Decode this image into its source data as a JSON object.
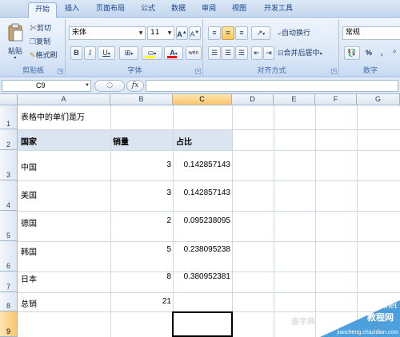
{
  "ribbon": {
    "tabs": [
      "开始",
      "插入",
      "页面布局",
      "公式",
      "数据",
      "审阅",
      "视图",
      "开发工具"
    ],
    "clipboard": {
      "paste": "粘贴",
      "cut": "剪切",
      "copy": "复制",
      "format_painter": "格式刷",
      "label": "剪贴板"
    },
    "font": {
      "name": "宋体",
      "size": "11",
      "grow": "A",
      "shrink": "A",
      "bold": "B",
      "italic": "I",
      "underline": "U",
      "label": "字体",
      "color_swatch": "#ff0000",
      "fill_swatch": "#ffff00",
      "wen": "wén"
    },
    "alignment": {
      "wrap_text": "自动换行",
      "merge_center": "合并后居中",
      "label": "对齐方式"
    },
    "number": {
      "format": "常规",
      "percent": "%",
      "comma": ",",
      "label": "数字"
    }
  },
  "formula_bar": {
    "cell_ref": "C9",
    "fx": "fx",
    "formula": ""
  },
  "grid": {
    "columns": [
      "A",
      "B",
      "C",
      "D",
      "E",
      "F",
      "G"
    ],
    "rows": [
      "1",
      "2",
      "3",
      "4",
      "5",
      "6",
      "7",
      "8",
      "9"
    ],
    "selected_cell": "C9",
    "title": "表格中的单们是万",
    "headers": {
      "country": "国家",
      "sales": "销量",
      "ratio": "占比"
    },
    "records": [
      {
        "country": "中国",
        "sales": "3",
        "ratio": "0.142857143"
      },
      {
        "country": "美国",
        "sales": "3",
        "ratio": "0.142857143"
      },
      {
        "country": "德国",
        "sales": "2",
        "ratio": "0.095238095"
      },
      {
        "country": "韩国",
        "sales": "5",
        "ratio": "0.238095238"
      },
      {
        "country": "日本",
        "sales": "8",
        "ratio": "0.380952381"
      }
    ],
    "total": {
      "label": "总销",
      "sales": "21"
    }
  },
  "watermark": {
    "site": "jb51.net",
    "tagline": "教程网",
    "url": "jiaocheng.chazidian.com",
    "prefix": "查字典"
  }
}
